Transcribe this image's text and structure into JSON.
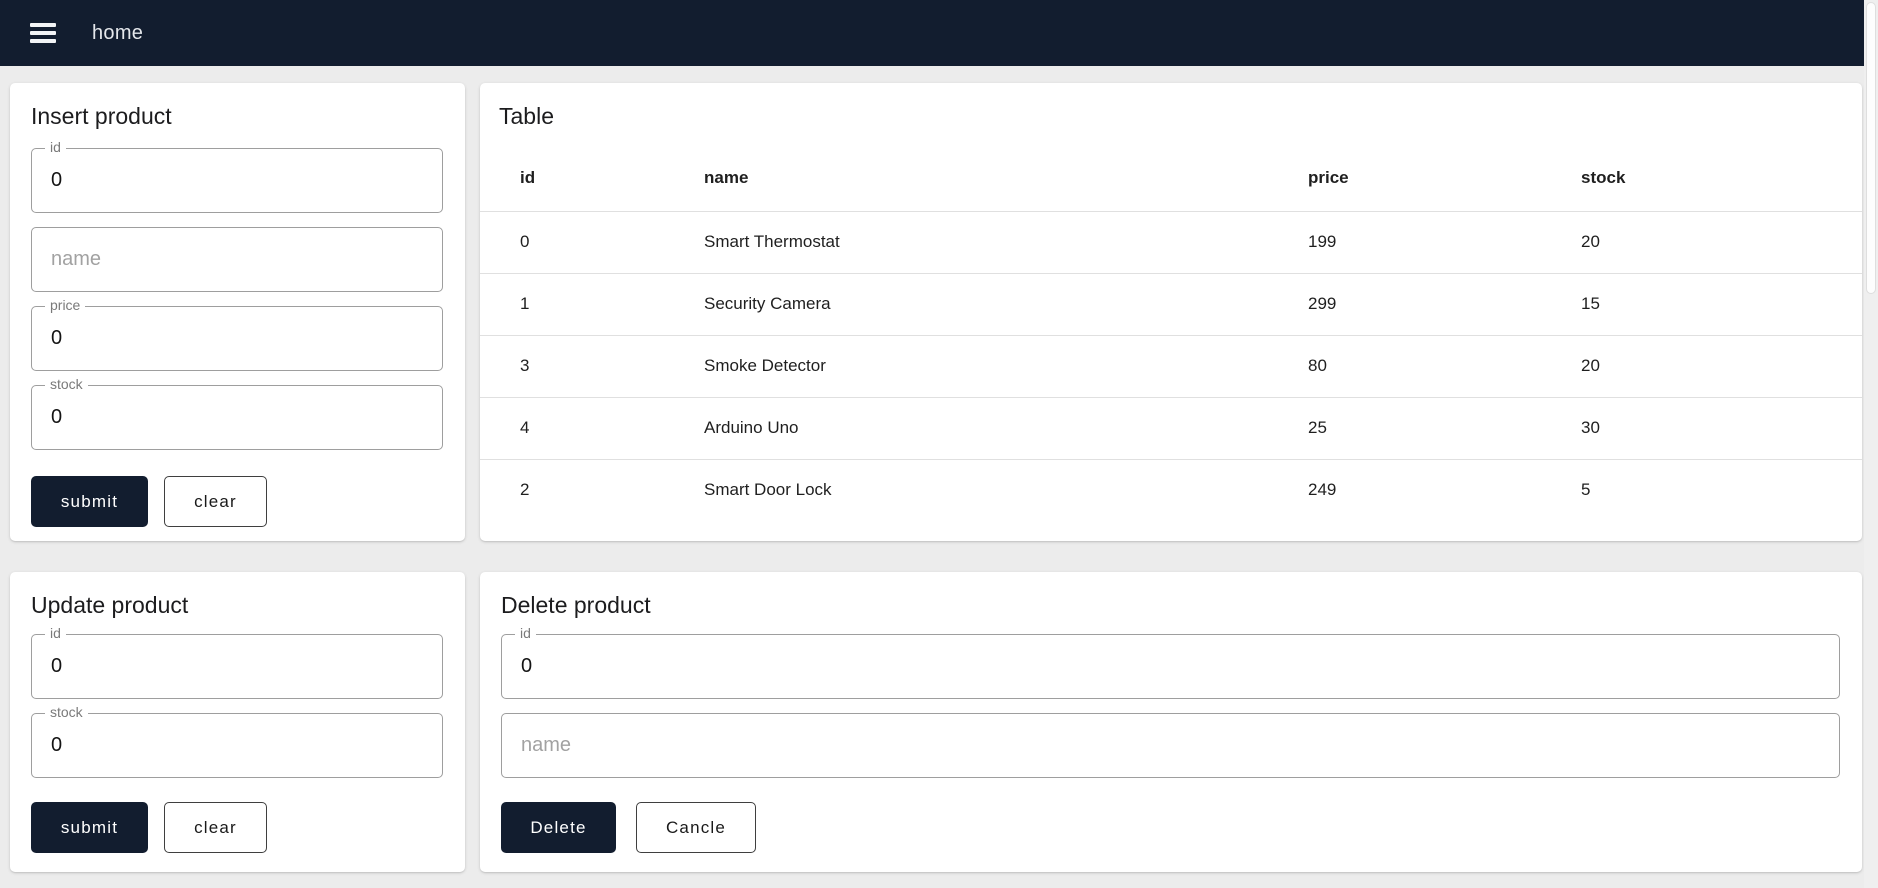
{
  "appbar": {
    "title": "home"
  },
  "colors": {
    "primary": "#121d2f",
    "page_bg": "#ececec",
    "card_bg": "#ffffff",
    "input_border": "#9e9e9e",
    "divider": "#e0e0e0",
    "label_text": "#7a7a7a",
    "placeholder_text": "#a2a2a2"
  },
  "insert_card": {
    "title": "Insert product",
    "id_field": {
      "label": "id",
      "value": "0"
    },
    "name_field": {
      "placeholder": "name",
      "value": ""
    },
    "price_field": {
      "label": "price",
      "value": "0"
    },
    "stock_field": {
      "label": "stock",
      "value": "0"
    },
    "submit_label": "submit",
    "clear_label": "clear"
  },
  "table_card": {
    "title": "Table",
    "columns": {
      "id": "id",
      "name": "name",
      "price": "price",
      "stock": "stock"
    },
    "rows": [
      {
        "id": "0",
        "name": "Smart Thermostat",
        "price": "199",
        "stock": "20"
      },
      {
        "id": "1",
        "name": "Security Camera",
        "price": "299",
        "stock": "15"
      },
      {
        "id": "3",
        "name": "Smoke Detector",
        "price": "80",
        "stock": "20"
      },
      {
        "id": "4",
        "name": "Arduino Uno",
        "price": "25",
        "stock": "30"
      },
      {
        "id": "2",
        "name": "Smart Door Lock",
        "price": "249",
        "stock": "5"
      }
    ]
  },
  "update_card": {
    "title": "Update product",
    "id_field": {
      "label": "id",
      "value": "0"
    },
    "stock_field": {
      "label": "stock",
      "value": "0"
    },
    "submit_label": "submit",
    "clear_label": "clear"
  },
  "delete_card": {
    "title": "Delete product",
    "id_field": {
      "label": "id",
      "value": "0"
    },
    "name_field": {
      "placeholder": "name",
      "value": ""
    },
    "delete_label": "Delete",
    "cancel_label": "Cancle"
  }
}
